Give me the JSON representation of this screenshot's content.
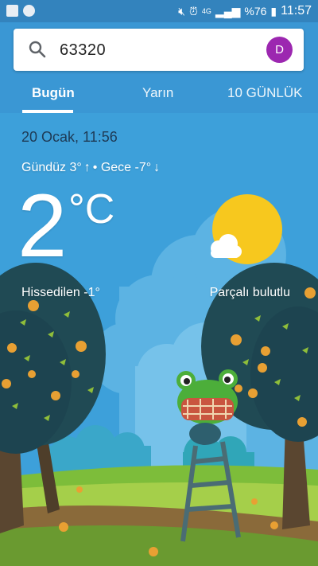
{
  "statusbar": {
    "battery": "%76",
    "time": "11:57",
    "signal_label": "4G"
  },
  "search": {
    "query": "63320",
    "avatar_letter": "D"
  },
  "tabs": [
    {
      "label": "Bugün"
    },
    {
      "label": "Yarın"
    },
    {
      "label": "10 GÜNLÜK"
    }
  ],
  "weather": {
    "date": "20 Ocak, 11:56",
    "day_label": "Gündüz 3°",
    "night_label": "• Gece -7°",
    "up_arrow": "↑",
    "down_arrow": "↓",
    "temperature": "2",
    "unit": "°C",
    "feels_like": "Hissedilen -1°",
    "condition": "Parçalı bulutlu"
  },
  "colors": {
    "sky": "#3a97d4",
    "avatar": "#9c27b0",
    "sun": "#f5c518"
  }
}
